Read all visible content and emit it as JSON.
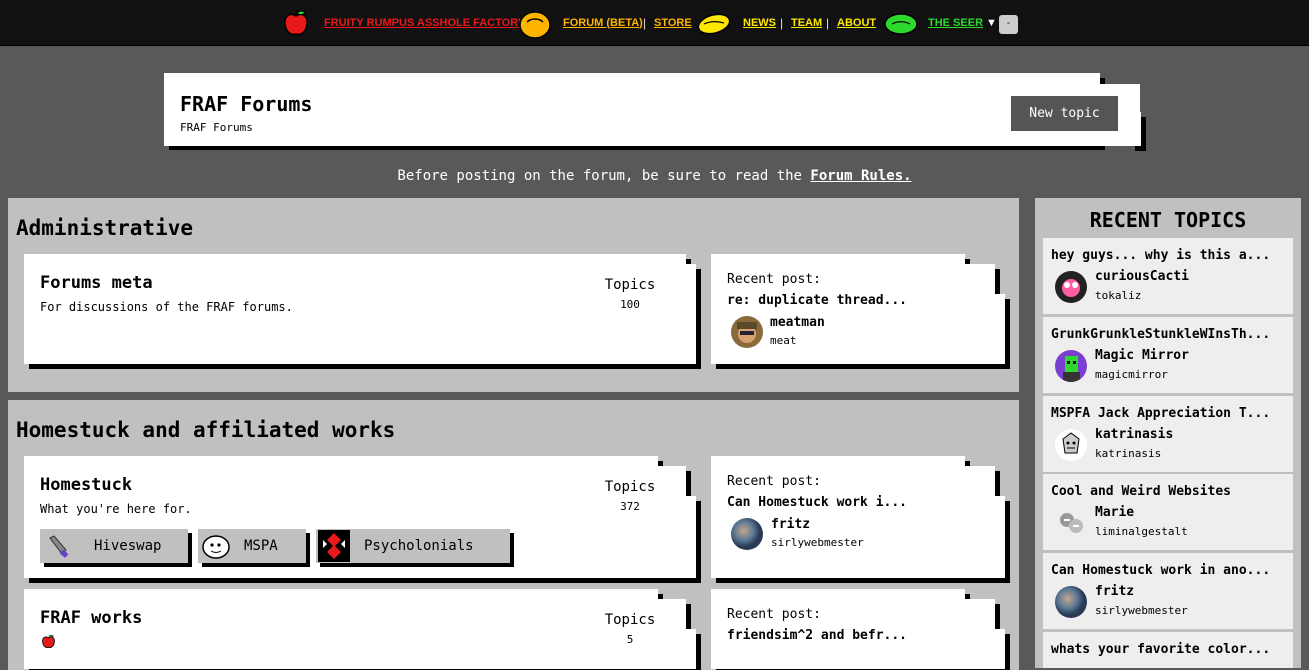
{
  "nav": {
    "site_name": "FRUITY RUMPUS ASSHOLE FACTORY",
    "forum": "FORUM (BETA)",
    "store": "STORE",
    "news": "NEWS",
    "team": "TEAM",
    "about": "ABOUT",
    "seer": "THE SEER",
    "caret": "▼",
    "minus": "-",
    "sep": "|",
    "colors": {
      "red": "#e8191a",
      "orange": "#ffb400",
      "yellow": "#ffe800",
      "green": "#2cd92c"
    }
  },
  "header": {
    "title": "FRAF Forums",
    "breadcrumb": "FRAF Forums",
    "new_topic": "New topic"
  },
  "notice": {
    "text": "Before posting on the forum, be sure to read the ",
    "link": "Forum Rules."
  },
  "categories": [
    {
      "title": "Administrative",
      "forums": [
        {
          "name": "Forums meta",
          "desc": "For discussions of the FRAF forums.",
          "topics_label": "Topics",
          "topics": "100",
          "recent_label": "Recent post:",
          "recent_title": "re: duplicate thread...",
          "recent_user": "meatman",
          "recent_handle": "meat"
        }
      ]
    },
    {
      "title": "Homestuck and affiliated works",
      "forums": [
        {
          "name": "Homestuck",
          "desc": "What you're here for.",
          "topics_label": "Topics",
          "topics": "372",
          "recent_label": "Recent post:",
          "recent_title": "Can Homestuck work i...",
          "recent_user": "fritz",
          "recent_handle": "sirlywebmester",
          "subforums": [
            "Hiveswap",
            "MSPA",
            "Psycholonials"
          ]
        },
        {
          "name": "FRAF works",
          "topics_label": "Topics",
          "topics": "5",
          "recent_label": "Recent post:",
          "recent_title": "friendsim^2 and befr..."
        }
      ]
    }
  ],
  "sidebar": {
    "title": "RECENT TOPICS",
    "topics": [
      {
        "title": "hey guys... why is this a...",
        "user": "curiousCacti",
        "handle": "tokaliz"
      },
      {
        "title": "GrunkGrunkleStunkleWInsTh...",
        "user": "Magic Mirror",
        "handle": "magicmirror"
      },
      {
        "title": "MSPFA Jack Appreciation T...",
        "user": "katrinasis",
        "handle": "katrinasis"
      },
      {
        "title": "Cool and Weird Websites",
        "user": "Marie",
        "handle": "liminalgestalt"
      },
      {
        "title": "Can Homestuck work in ano...",
        "user": "fritz",
        "handle": "sirlywebmester"
      },
      {
        "title": "whats your favorite color..."
      }
    ]
  }
}
